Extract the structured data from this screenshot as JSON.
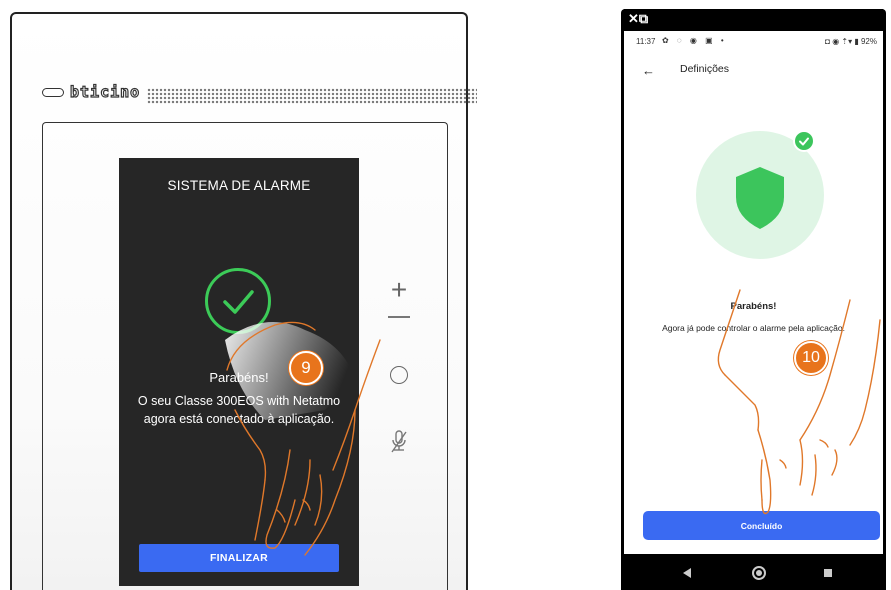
{
  "left_device": {
    "brand": "bticino",
    "screen": {
      "title": "SISTEMA DE ALARME",
      "message_title": "Parabéns!",
      "message": "O seu Classe 300EOS with Netatmo agora está conectado à aplicação.",
      "finalize_button": "FINALIZAR"
    },
    "step_number": "9"
  },
  "right_phone": {
    "status": {
      "time": "11:37",
      "battery": "92%"
    },
    "header": {
      "back_icon": "arrow-left-icon",
      "title": "Definições"
    },
    "congrats_title": "Parabéns!",
    "congrats_message": "Agora já pode controlar o alarme pela aplicação.",
    "done_button": "Concluído",
    "step_number": "10"
  },
  "colors": {
    "accent_blue": "#3a6af2",
    "success_green": "#3cc55c",
    "step_marker_orange": "#e8741c",
    "device_screen": "#262626"
  }
}
